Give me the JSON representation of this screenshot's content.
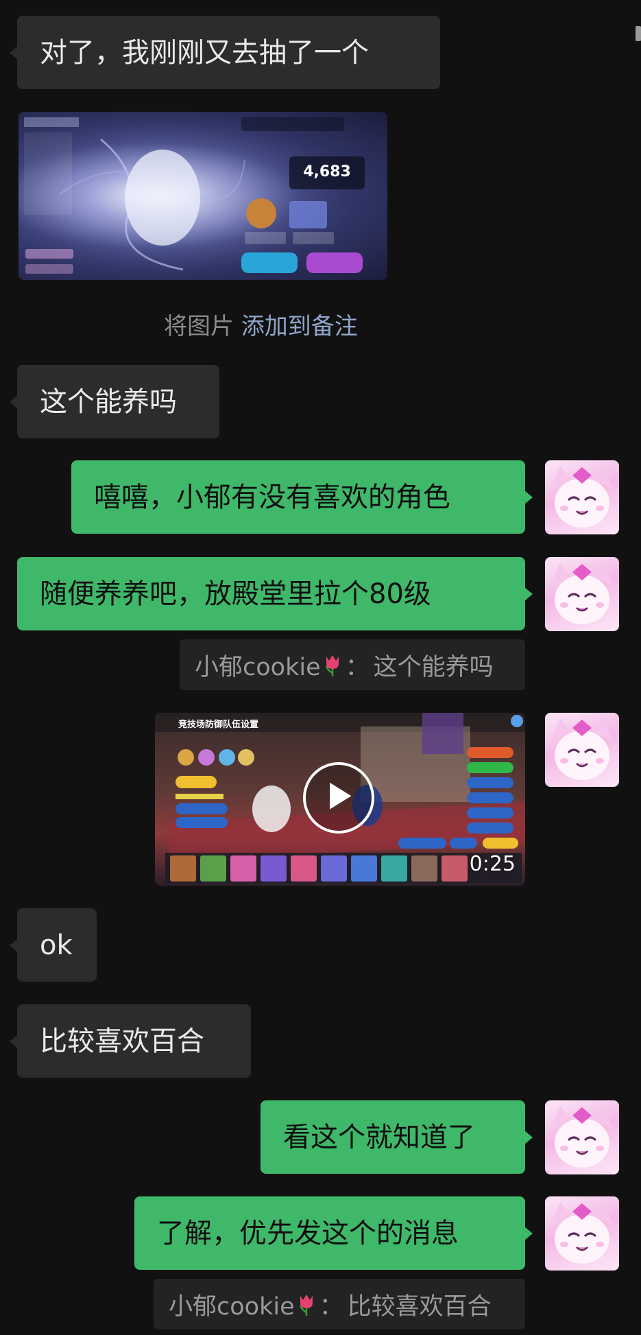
{
  "messages": {
    "m1": "对了，我刚刚又去抽了一个",
    "m2": "这个能养吗",
    "m3": "嘻嘻，小郁有没有喜欢的角色",
    "m4": "随便养养吧，放殿堂里拉个80级",
    "m5": "ok",
    "m6": "比较喜欢百合",
    "m7": "看这个就知道了",
    "m8": "了解，优先发这个的消息"
  },
  "image_card": {
    "score": "4,683"
  },
  "note_hint": {
    "prefix": "将图片",
    "link": "添加到备注"
  },
  "quotes": {
    "q1": {
      "sender": "小郁cookie",
      "separator": "：",
      "text": "这个能养吗"
    },
    "q2": {
      "sender": "小郁cookie",
      "separator": "：",
      "text": "比较喜欢百合"
    }
  },
  "video": {
    "title": "竞技场防御队伍设置",
    "duration": "0:25"
  },
  "icons": {
    "avatar": "pink-cat-character-avatar-icon",
    "play": "play-icon",
    "tulip": "tulip-emoji-icon"
  },
  "colors": {
    "background": "#111111",
    "incoming_bubble": "#2c2c2c",
    "outgoing_bubble": "#3fb86a",
    "link": "#8fa6c9"
  }
}
